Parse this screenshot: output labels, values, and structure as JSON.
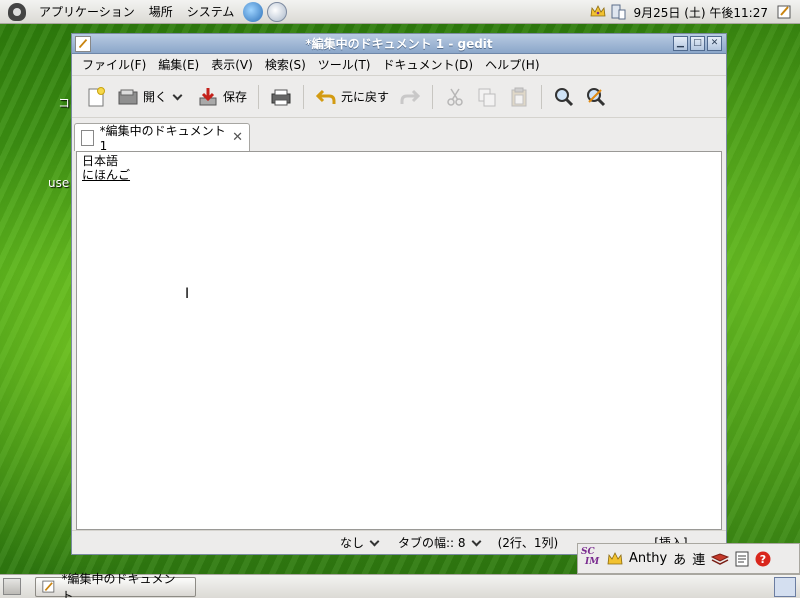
{
  "top_panel": {
    "menus": [
      "アプリケーション",
      "場所",
      "システム"
    ],
    "clock": "9月25日 (土) 午後11:27"
  },
  "desktop": {
    "icon_labels": [
      "コ",
      "use"
    ]
  },
  "window": {
    "title": "*編集中のドキュメント 1 - gedit",
    "menubar": [
      "ファイル(F)",
      "編集(E)",
      "表示(V)",
      "検索(S)",
      "ツール(T)",
      "ドキュメント(D)",
      "ヘルプ(H)"
    ],
    "toolbar": {
      "open_label": "開く",
      "save_label": "保存",
      "undo_label": "元に戻す"
    },
    "tab": {
      "label": "*編集中のドキュメント 1"
    },
    "editor": {
      "line1": "日本語",
      "line2": "にほんご"
    },
    "statusbar": {
      "language": "なし",
      "tab_width": "タブの幅:: 8",
      "position": "(2行、1列)",
      "mode": "[挿入]"
    }
  },
  "scim": {
    "logo_top": "SC",
    "logo_bottom": "IM",
    "engine": "Anthy",
    "input_mode": "あ",
    "conversion_mode": "連"
  },
  "bottom_panel": {
    "task_label": "*編集中のドキュメント…"
  },
  "colors": {
    "titlebar": "#8ba6c9",
    "desktop_green": "#3f8f12",
    "help_red": "#d9261c"
  }
}
